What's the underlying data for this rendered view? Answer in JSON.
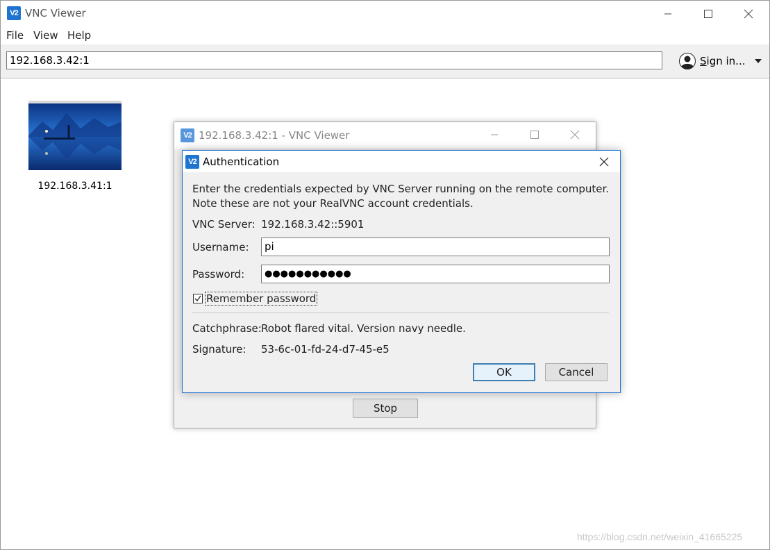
{
  "app": {
    "title": "VNC Viewer",
    "logo_text": "V2"
  },
  "menu": {
    "file": "File",
    "view": "View",
    "help": "Help"
  },
  "toolbar": {
    "address_value": "192.168.3.42:1",
    "signin_first": "S",
    "signin_rest": "ign in...",
    "signin_icon": "user-avatar-icon",
    "dropdown_icon": "caret-down-icon"
  },
  "computers": [
    {
      "label": "192.168.3.41:1"
    }
  ],
  "connection_window": {
    "title": "192.168.3.42:1 - VNC Viewer",
    "stop_label": "Stop"
  },
  "auth_dialog": {
    "title": "Authentication",
    "intro_line1": "Enter the credentials expected by VNC Server running on the remote computer.",
    "intro_line2": "Note these are not your RealVNC account credentials.",
    "server_label": "VNC Server:",
    "server_value": "192.168.3.42::5901",
    "username_label": "Username:",
    "username_value": "pi",
    "password_label": "Password:",
    "password_display": "●●●●●●●●●●●",
    "remember_label": "Remember password",
    "remember_checked": true,
    "catchphrase_label": "Catchphrase:",
    "catchphrase_value": "Robot flared vital. Version navy needle.",
    "signature_label": "Signature:",
    "signature_value": "53-6c-01-fd-24-d7-45-e5",
    "ok_label": "OK",
    "cancel_label": "Cancel"
  },
  "watermark": "https://blog.csdn.net/weixin_41665225",
  "colors": {
    "accent": "#1f73d1",
    "toolbar_bg": "#f0f0f0",
    "ok_border": "#3c7fb1"
  }
}
